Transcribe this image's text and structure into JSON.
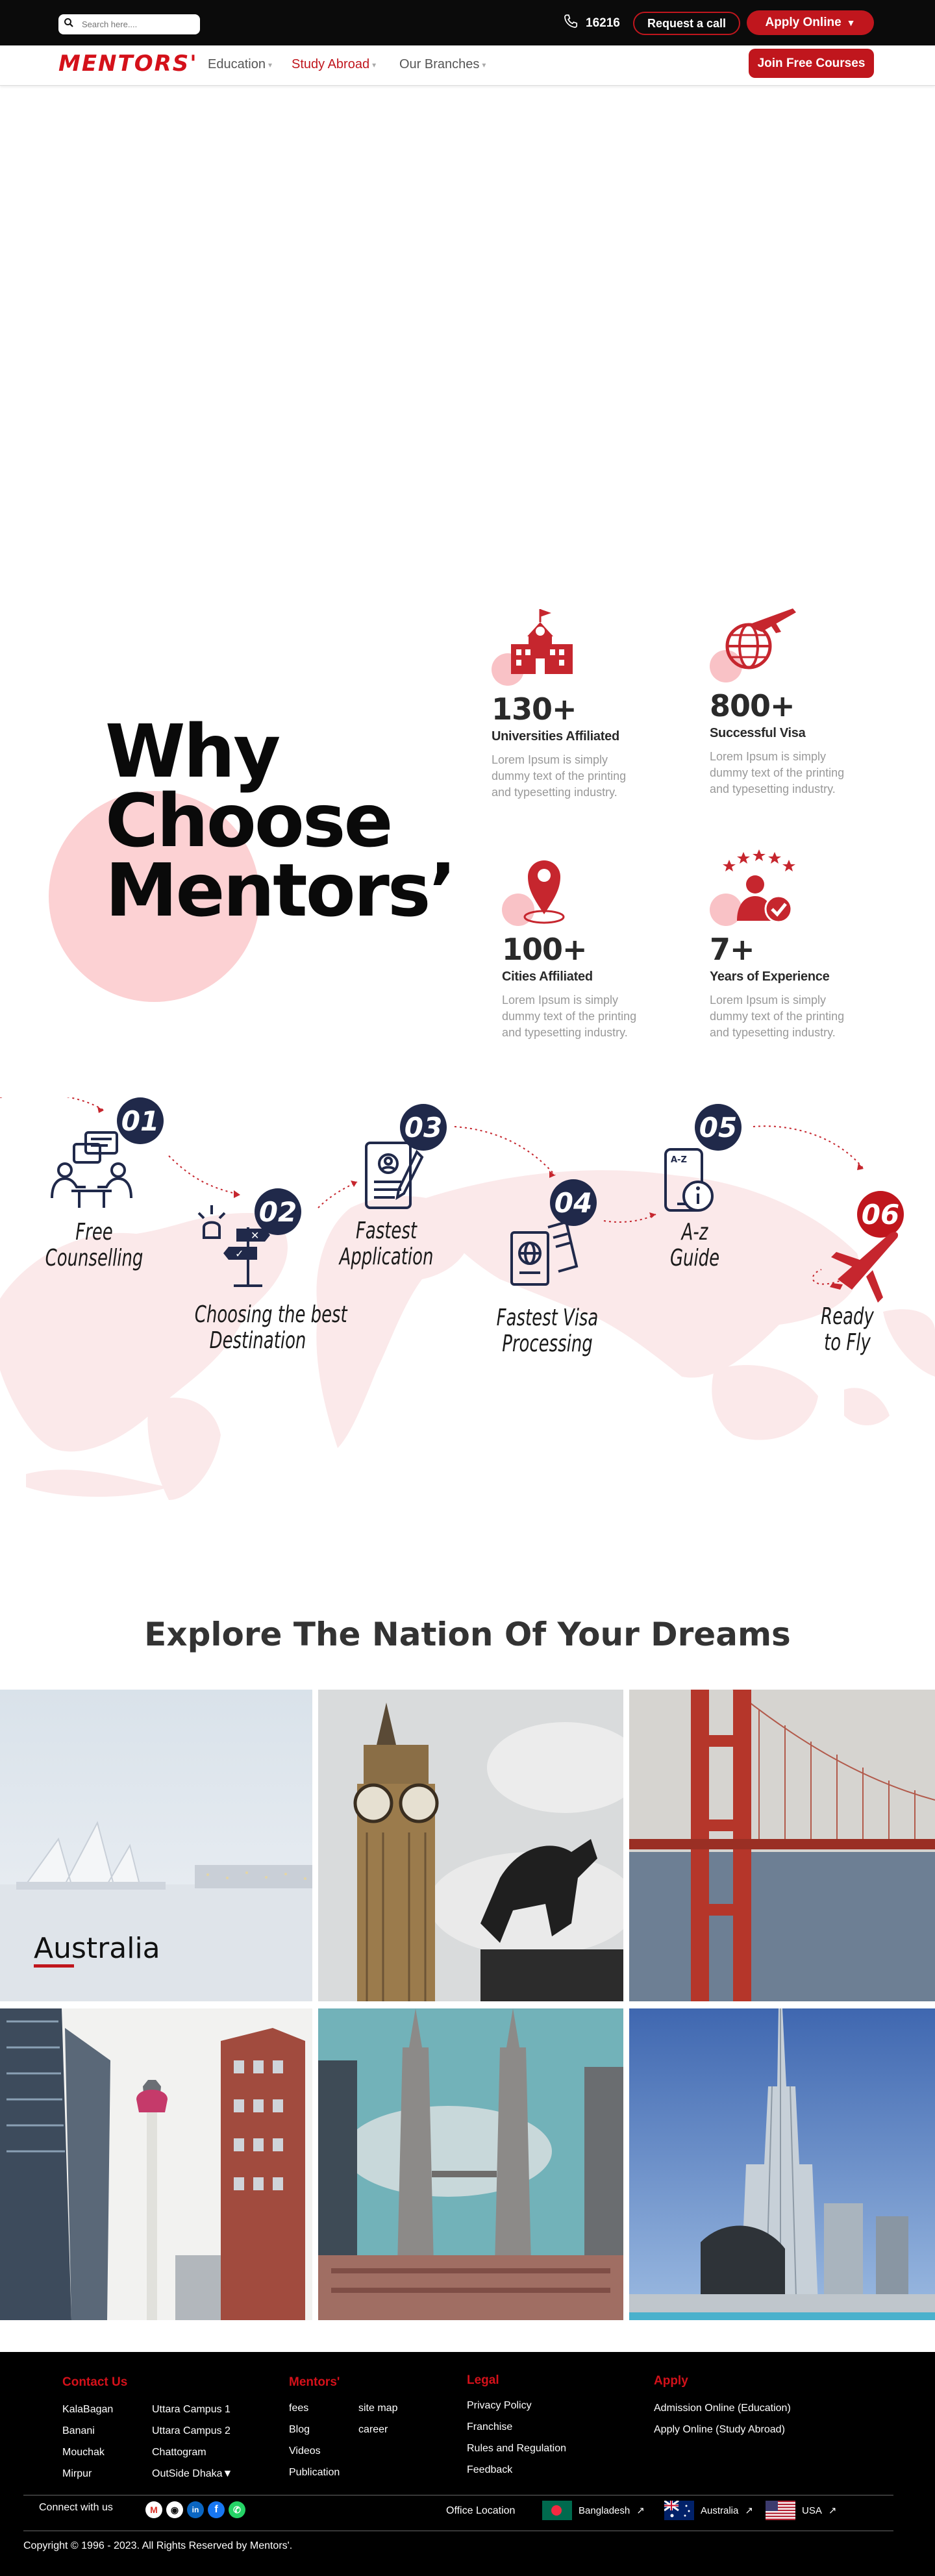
{
  "topbar": {
    "search_placeholder": "Search here....",
    "phone": "16216",
    "request_call": "Request a call",
    "apply_online": "Apply Online"
  },
  "nav": {
    "logo": "MENTORS'",
    "items": [
      {
        "label": "Education"
      },
      {
        "label": "Study Abroad"
      },
      {
        "label": "Our Branches"
      }
    ],
    "join_button": "Join Free Courses"
  },
  "why": {
    "title_lines": [
      "Why",
      "Choose",
      "Mentors’"
    ],
    "stats": [
      {
        "value": "130+",
        "label": "Universities Affiliated",
        "desc": "Lorem Ipsum is simply dummy text of the printing and typesetting industry.",
        "icon": "school-building-icon"
      },
      {
        "value": "800+",
        "label": "Successful Visa",
        "desc": "Lorem Ipsum is simply dummy text of the printing and typesetting industry.",
        "icon": "globe-plane-icon"
      },
      {
        "value": "100+",
        "label": "Cities Affiliated",
        "desc": "Lorem Ipsum is simply dummy text of the printing and typesetting industry.",
        "icon": "location-pin-icon"
      },
      {
        "value": "7+",
        "label": "Years of Experience",
        "desc": "Lorem Ipsum is simply dummy text of the printing and typesetting industry.",
        "icon": "experience-person-icon"
      }
    ]
  },
  "process": {
    "steps": [
      {
        "num": "01",
        "label_lines": [
          "Free",
          "Counselling"
        ],
        "icon": "counselling-icon"
      },
      {
        "num": "02",
        "label_lines": [
          "Choosing the best",
          "Destination"
        ],
        "icon": "signpost-icon"
      },
      {
        "num": "03",
        "label_lines": [
          "Fastest",
          "Application"
        ],
        "icon": "application-form-icon"
      },
      {
        "num": "04",
        "label_lines": [
          "Fastest Visa",
          "Processing"
        ],
        "icon": "passport-visa-icon"
      },
      {
        "num": "05",
        "label_lines": [
          "A-z",
          "Guide"
        ],
        "icon": "guide-info-icon"
      },
      {
        "num": "06",
        "label_lines": [
          "Ready",
          "to Fly"
        ],
        "icon": "airplane-icon"
      }
    ]
  },
  "explore": {
    "title": "Explore The Nation Of Your Dreams",
    "tiles": [
      {
        "label": "Australia",
        "scene": "sydney-opera-house"
      },
      {
        "label": "",
        "scene": "big-ben-london"
      },
      {
        "label": "",
        "scene": "golden-gate-bridge"
      },
      {
        "label": "",
        "scene": "calgary-tower"
      },
      {
        "label": "",
        "scene": "petronas-towers"
      },
      {
        "label": "",
        "scene": "burj-khalifa"
      }
    ]
  },
  "footer": {
    "contact": {
      "heading": "Contact Us",
      "col1": [
        "KalaBagan",
        "Banani",
        "Mouchak",
        "Mirpur"
      ],
      "col2": [
        "Uttara Campus 1",
        "Uttara Campus 2",
        "Chattogram",
        "OutSide Dhaka▼"
      ]
    },
    "mentors": {
      "heading": "Mentors'",
      "col1": [
        "fees",
        "Blog",
        "Videos",
        "Publication"
      ],
      "col2": [
        "site map",
        "career"
      ]
    },
    "legal": {
      "heading": "Legal",
      "links": [
        "Privacy Policy",
        "Franchise",
        "Rules and Regulation",
        "Feedback"
      ]
    },
    "apply": {
      "heading": "Apply",
      "links": [
        "Admission Online (Education)",
        "Apply Online (Study Abroad)"
      ]
    },
    "connect_label": "Connect with us",
    "social": [
      "gmail-icon",
      "github-icon",
      "linkedin-icon",
      "facebook-icon",
      "whatsapp-icon"
    ],
    "office_label": "Office Location",
    "offices": [
      {
        "name": "Bangladesh",
        "flag": "bangladesh-flag"
      },
      {
        "name": "Australia",
        "flag": "australia-flag"
      },
      {
        "name": "USA",
        "flag": "usa-flag"
      }
    ],
    "copyright": "Copyright © 1996 - 2023. All Rights Reserved by Mentors'."
  },
  "colors": {
    "brand_red": "#c0161d",
    "navy": "#20294a",
    "pink": "#fcd1d3",
    "black": "#0b0b0b"
  }
}
